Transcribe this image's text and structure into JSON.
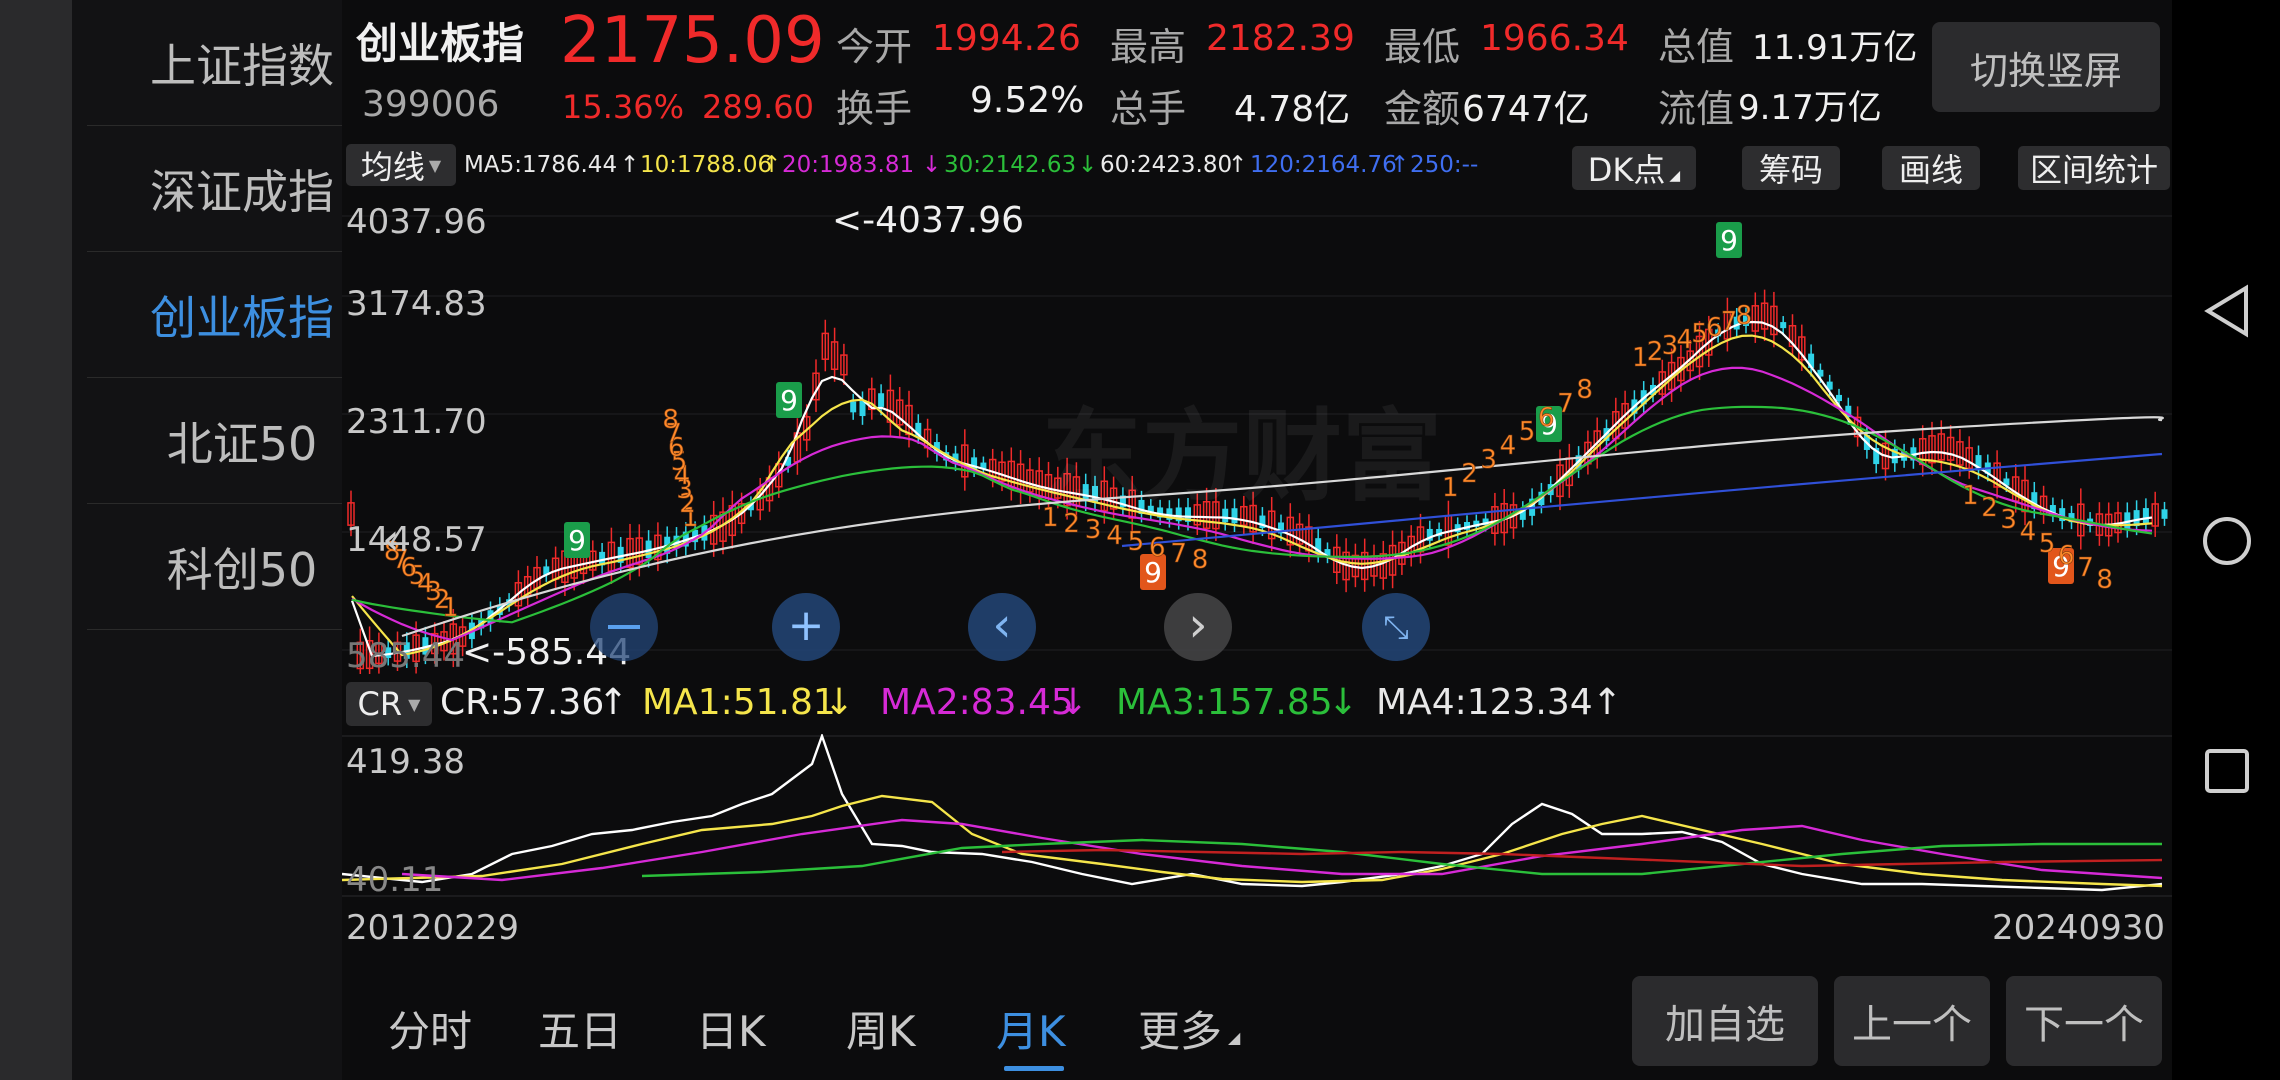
{
  "sidebar": {
    "items": [
      {
        "label": "上证指数",
        "active": false
      },
      {
        "label": "深证成指",
        "active": false
      },
      {
        "label": "创业板指",
        "active": true
      },
      {
        "label": "北证50",
        "active": false
      },
      {
        "label": "科创50",
        "active": false
      }
    ]
  },
  "header": {
    "name": "创业板指",
    "code": "399006",
    "price": "2175.09",
    "change_pct": "15.36%",
    "change_abs": "289.60",
    "stats": {
      "open_label": "今开",
      "open": "1994.26",
      "high_label": "最高",
      "high": "2182.39",
      "low_label": "最低",
      "low": "1966.34",
      "total_value_label": "总值",
      "total_value": "11.91万亿",
      "turnover_label": "换手",
      "turnover": "9.52%",
      "volume_label": "总手",
      "volume": "4.78亿",
      "amount_label": "金额",
      "amount": "6747亿",
      "float_value_label": "流值",
      "float_value": "9.17万亿"
    },
    "switch_button": "切换竖屏"
  },
  "ma_bar": {
    "selector": "均线",
    "ma5": "MA5:1786.44",
    "ma10": "10:1788.06",
    "ma20": "20:1983.81",
    "ma30": "30:2142.63",
    "ma60": "60:2423.80",
    "ma120": "120:2164.76",
    "ma250": "250:--",
    "dk_button": "DK点",
    "chip_button": "筹码",
    "draw_button": "画线",
    "range_button": "区间统计"
  },
  "main_chart": {
    "y_labels": [
      "4037.96",
      "3174.83",
      "2311.70",
      "1448.57",
      "585.44"
    ],
    "max_annotation": "<-4037.96",
    "min_annotation": "<-585.44",
    "signal_nines": [
      "9",
      "9",
      "9",
      "9",
      "9",
      "9"
    ],
    "buy_counts": [
      "1",
      "2",
      "3",
      "4",
      "5",
      "6",
      "7",
      "8"
    ],
    "watermark": "东方财富"
  },
  "cr_bar": {
    "selector": "CR",
    "cr": "CR:57.36",
    "ma1": "MA1:51.81",
    "ma2": "MA2:83.45",
    "ma3": "MA3:157.85",
    "ma4": "MA4:123.34",
    "y_top": "419.38",
    "y_bottom": "40.11"
  },
  "dates": {
    "start": "20120229",
    "end": "20240930"
  },
  "tabs": {
    "items": [
      "分时",
      "五日",
      "日K",
      "周K",
      "月K",
      "更多"
    ],
    "active_index": 4
  },
  "actions": {
    "add_watch": "加自选",
    "prev": "上一个",
    "next": "下一个"
  },
  "colors": {
    "up": "#f02a2a",
    "down": "#2fd3e8",
    "accent": "#3d8fe0",
    "ma5": "#ffffff",
    "ma10": "#f5e54b",
    "ma20": "#d62ad6",
    "ma30": "#2bbf3a",
    "ma60": "#d8d8d8",
    "ma120": "#3050d8"
  },
  "icons": {
    "back": "triangle-left-icon",
    "home": "circle-icon",
    "recents": "square-icon"
  }
}
